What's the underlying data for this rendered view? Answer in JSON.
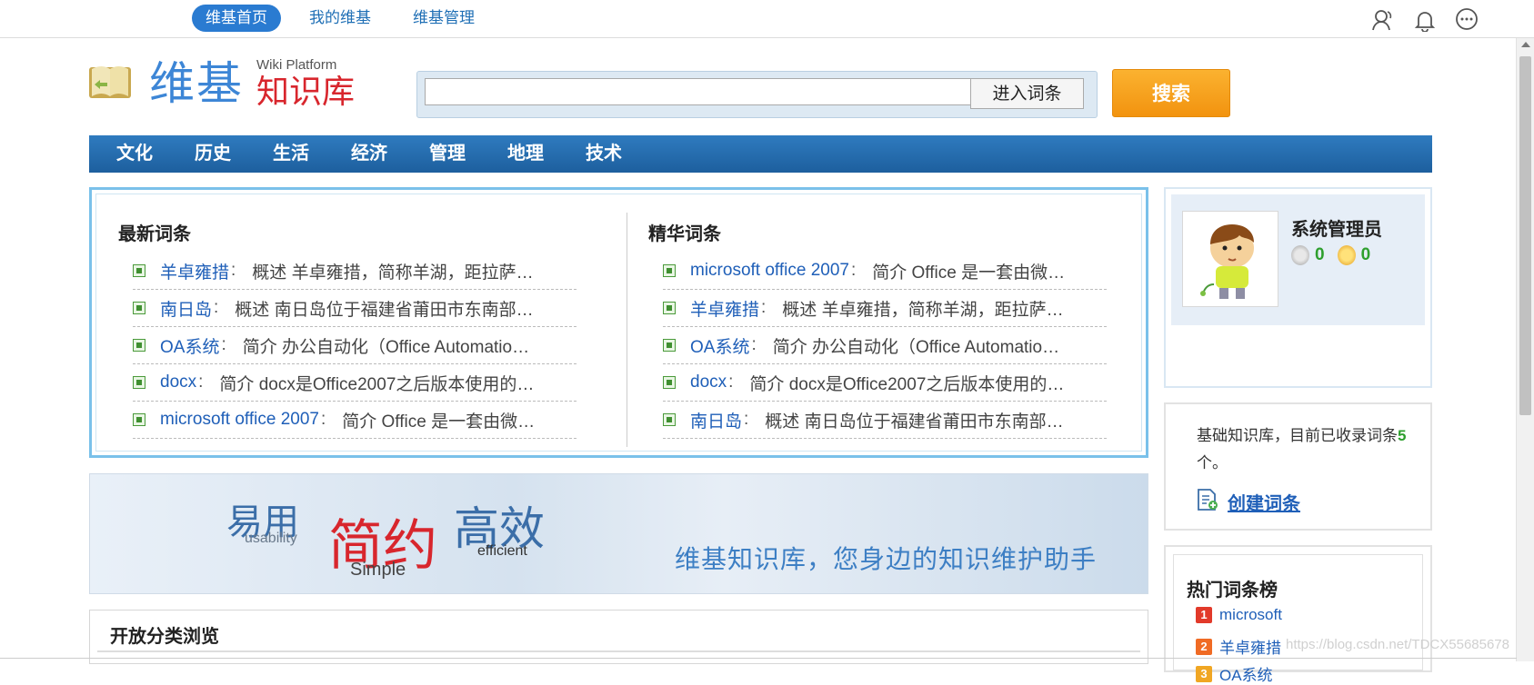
{
  "topnav": {
    "items": [
      {
        "label": "维基首页",
        "active": true
      },
      {
        "label": "我的维基",
        "active": false
      },
      {
        "label": "维基管理",
        "active": false
      }
    ],
    "icons": [
      "user-icon",
      "bell-icon",
      "chat-icon"
    ]
  },
  "logo": {
    "title": "维基",
    "en": "Wiki Platform",
    "cn": "知识库"
  },
  "search": {
    "value": "",
    "enter_label": "进入词条",
    "search_label": "搜索"
  },
  "categories": [
    "文化",
    "历史",
    "生活",
    "经济",
    "管理",
    "地理",
    "技术"
  ],
  "latest": {
    "heading": "最新词条",
    "items": [
      {
        "title": "羊卓雍措",
        "summary": "概述 羊卓雍措，简称羊湖，距拉萨…"
      },
      {
        "title": "南日岛",
        "summary": "概述 南日岛位于福建省莆田市东南部…"
      },
      {
        "title": "OA系统",
        "summary": "简介 办公自动化（Office Automatio…"
      },
      {
        "title": "docx",
        "summary": "简介 docx是Office2007之后版本使用的…"
      },
      {
        "title": "microsoft office 2007",
        "summary": "简介 Office 是一套由微…"
      }
    ]
  },
  "featured": {
    "heading": "精华词条",
    "items": [
      {
        "title": "microsoft office 2007",
        "summary": "简介 Office 是一套由微…"
      },
      {
        "title": "羊卓雍措",
        "summary": "概述 羊卓雍措，简称羊湖，距拉萨…"
      },
      {
        "title": "OA系统",
        "summary": "简介 办公自动化（Office Automatio…"
      },
      {
        "title": "docx",
        "summary": "简介 docx是Office2007之后版本使用的…"
      },
      {
        "title": "南日岛",
        "summary": "概述 南日岛位于福建省莆田市东南部…"
      }
    ]
  },
  "banner": {
    "w1": "易用",
    "w1_en": "usability",
    "w2": "简约",
    "w2_en": "Simple",
    "w3": "高效",
    "w3_en": "efficient",
    "slogan": "维基知识库，您身边的知识维护助手"
  },
  "open_category": {
    "heading": "开放分类浏览"
  },
  "user": {
    "name": "系统管理员",
    "silver": "0",
    "gold": "0"
  },
  "info": {
    "text_before": "基础知识库，目前已收录词条",
    "count": "5",
    "text_after": "个。",
    "create_label": "创建词条"
  },
  "hot": {
    "heading": "热门词条榜",
    "items": [
      {
        "rank": "1",
        "title": "microsoft"
      },
      {
        "rank": "2",
        "title": "羊卓雍措"
      },
      {
        "rank": "3",
        "title": "OA系统"
      }
    ]
  },
  "watermark": "https://blog.csdn.net/TDCX55685678",
  "colors": {
    "accent": "#2a7bd1",
    "nav": "#1d5f9e",
    "search_button": "#f2930f",
    "title_red": "#d8262d"
  }
}
